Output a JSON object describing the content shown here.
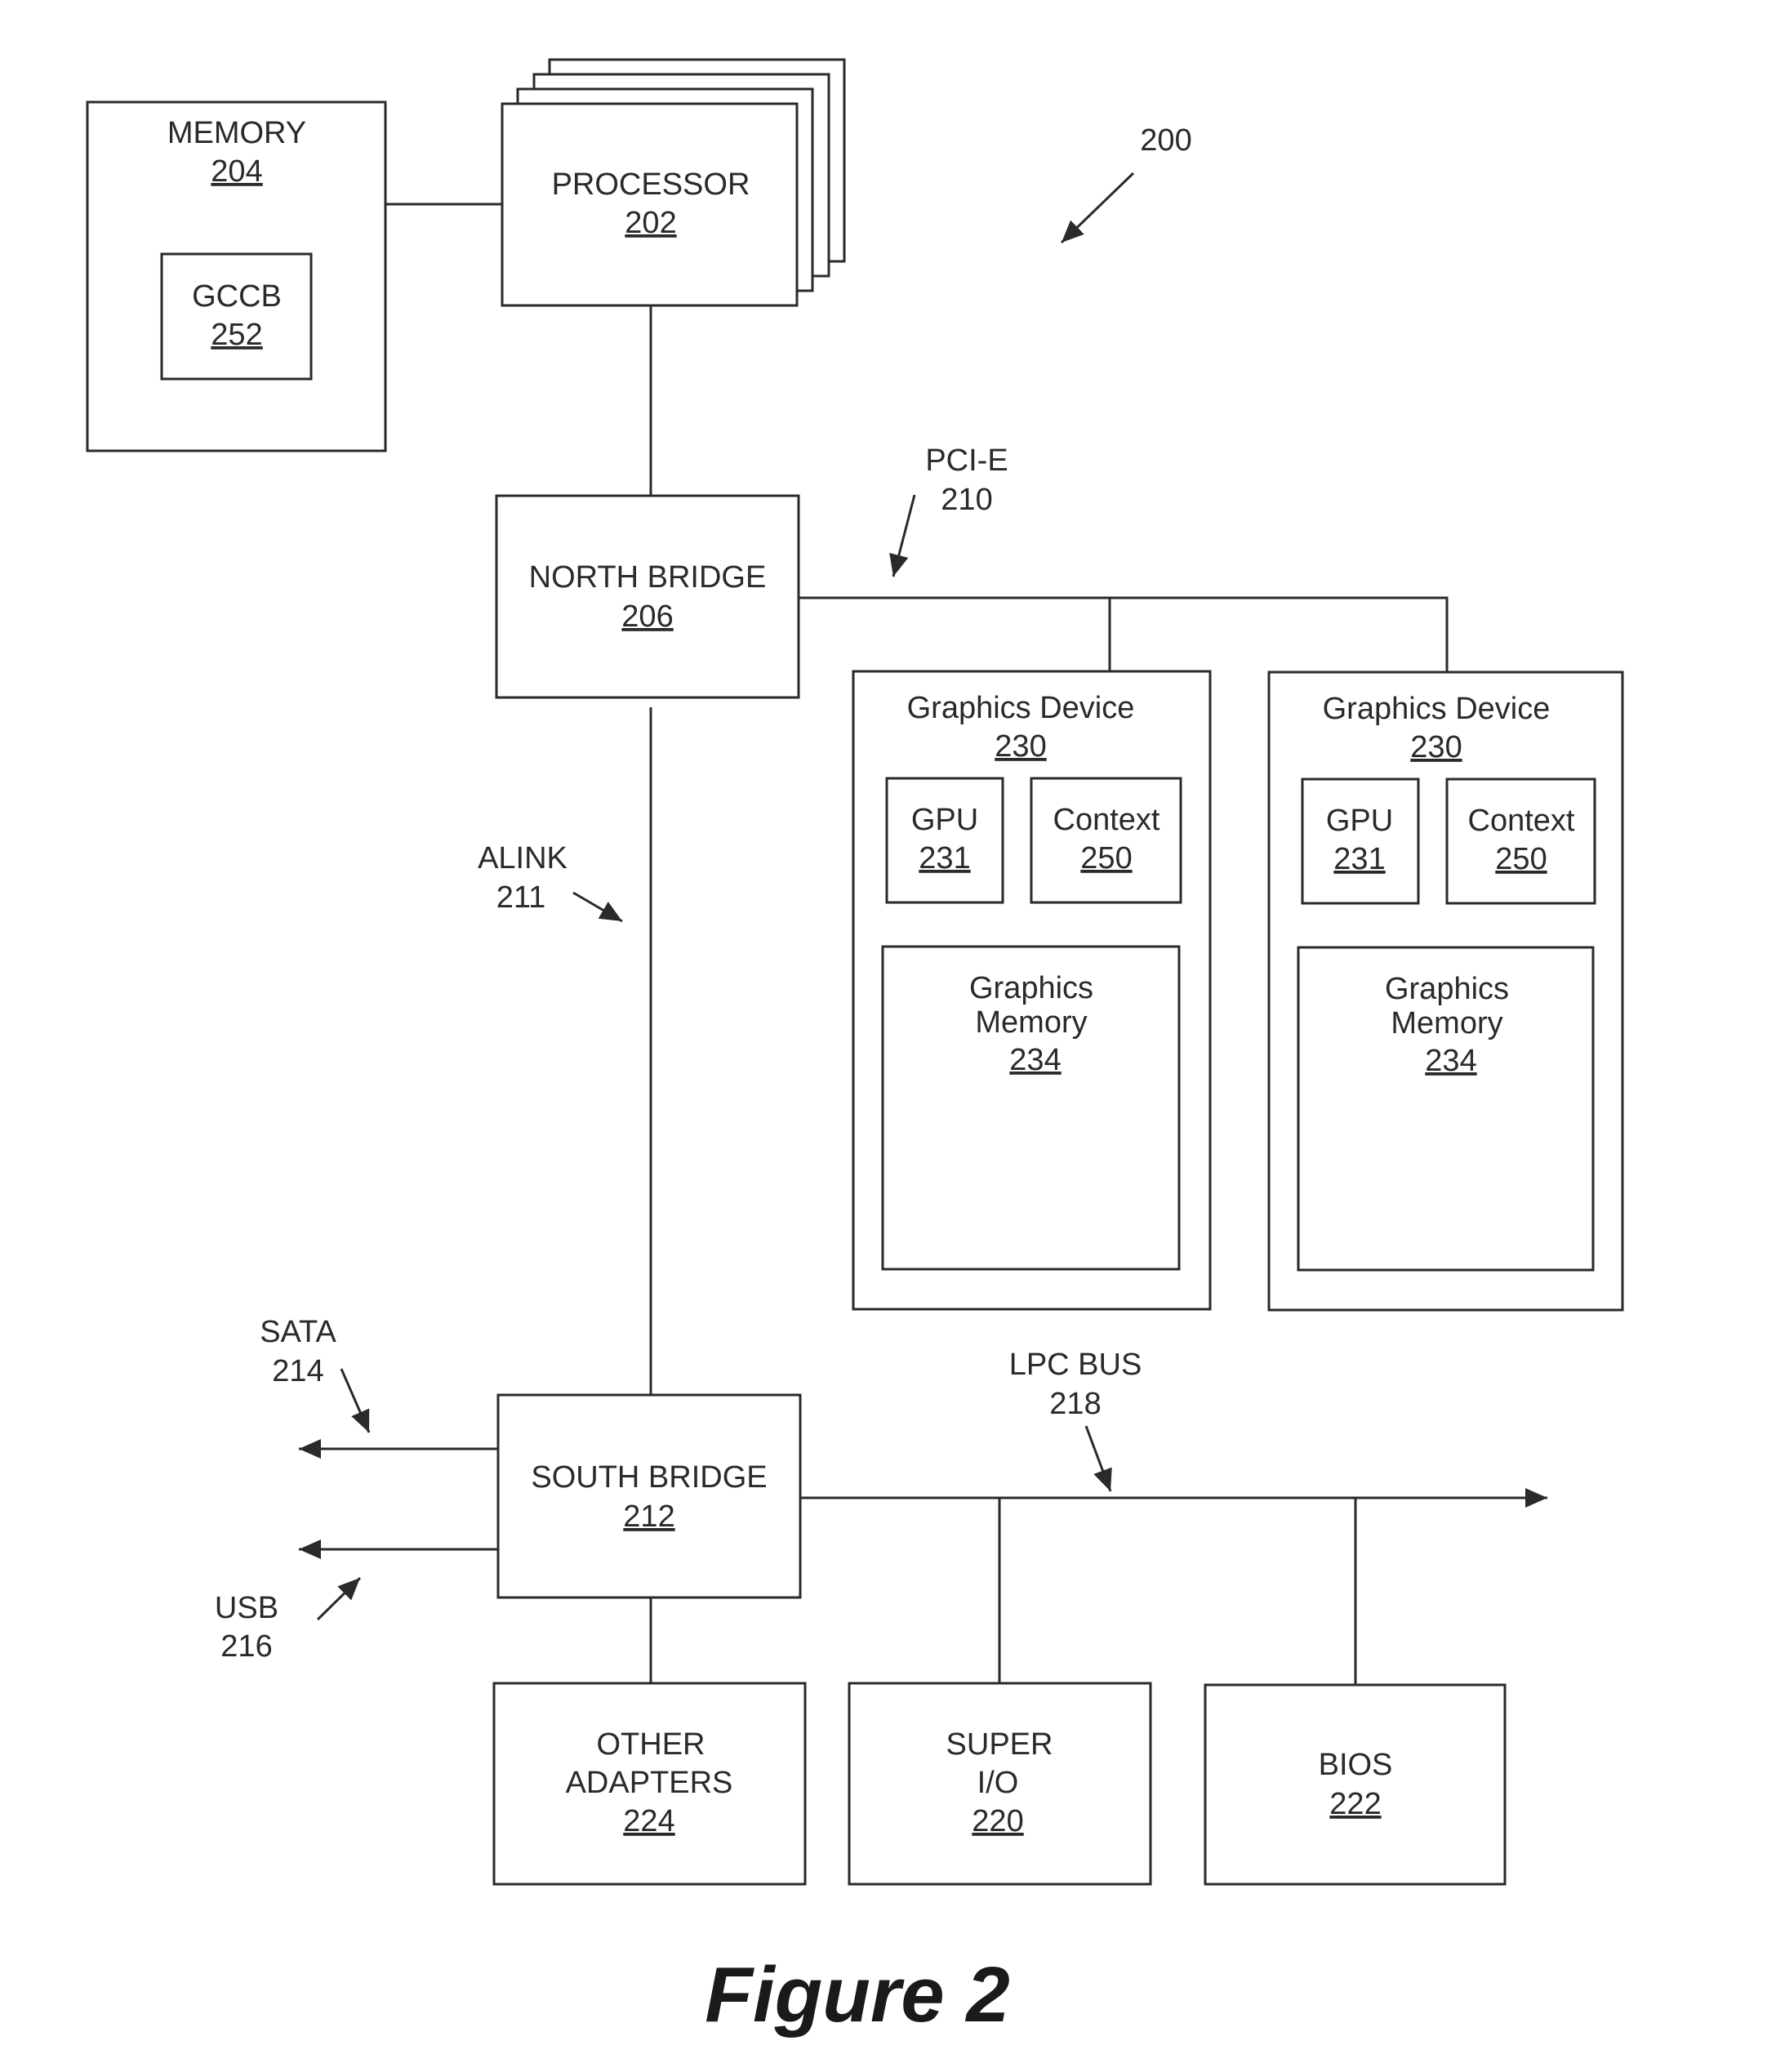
{
  "figure": {
    "caption": "Figure 2",
    "reference": "200",
    "line_color": "#2a2a2a"
  },
  "blocks": {
    "memory": {
      "label": "MEMORY",
      "number": "204"
    },
    "gccb": {
      "label": "GCCB",
      "number": "252"
    },
    "processor": {
      "label": "PROCESSOR",
      "number": "202"
    },
    "north_bridge": {
      "label": "NORTH BRIDGE",
      "number": "206"
    },
    "south_bridge": {
      "label": "SOUTH BRIDGE",
      "number": "212"
    },
    "other_adapters": {
      "label_line1": "OTHER",
      "label_line2": "ADAPTERS",
      "number": "224"
    },
    "super_io": {
      "label_line1": "SUPER",
      "label_line2": "I/O",
      "number": "220"
    },
    "bios": {
      "label": "BIOS",
      "number": "222"
    },
    "graphics_devices": [
      {
        "label": "Graphics Device",
        "number": "230",
        "gpu": {
          "label": "GPU",
          "number": "231"
        },
        "context": {
          "label": "Context",
          "number": "250"
        },
        "graphics_memory": {
          "label_line1": "Graphics",
          "label_line2": "Memory",
          "number": "234"
        }
      },
      {
        "label": "Graphics Device",
        "number": "230",
        "gpu": {
          "label": "GPU",
          "number": "231"
        },
        "context": {
          "label": "Context",
          "number": "250"
        },
        "graphics_memory": {
          "label_line1": "Graphics",
          "label_line2": "Memory",
          "number": "234"
        }
      }
    ]
  },
  "buses": {
    "pcie": {
      "label": "PCI-E",
      "number": "210"
    },
    "alink": {
      "label": "ALINK",
      "number": "211"
    },
    "sata": {
      "label": "SATA",
      "number": "214"
    },
    "usb": {
      "label": "USB",
      "number": "216"
    },
    "lpc": {
      "label": "LPC BUS",
      "number": "218"
    }
  }
}
